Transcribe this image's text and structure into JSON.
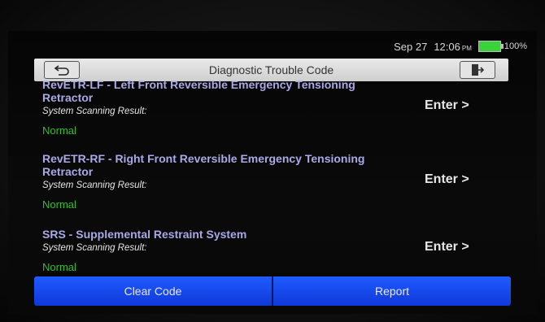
{
  "status_bar": {
    "date": "Sep 27",
    "time": "12:06",
    "ampm": "PM",
    "battery": "100%",
    "battery_color": "#3bd13b"
  },
  "header": {
    "title": "Diagnostic Trouble Code",
    "back_icon": "back-arrow-icon",
    "exit_icon": "exit-icon"
  },
  "systems": [
    {
      "title_line1": "RevETR-LF - Left Front Reversible Emergency Tensioning",
      "title_line2": "Retractor",
      "scan_label": "System Scanning Result:",
      "status": "Normal",
      "action": "Enter >"
    },
    {
      "title_line1": "RevETR-RF - Right Front Reversible Emergency Tensioning",
      "title_line2": "Retractor",
      "scan_label": "System Scanning Result:",
      "status": "Normal",
      "action": "Enter >"
    },
    {
      "title_line1": "SRS - Supplemental Restraint System",
      "title_line2": "",
      "scan_label": "System Scanning Result:",
      "status": "Normal",
      "action": "Enter >"
    }
  ],
  "footer": {
    "clear_label": "Clear Code",
    "report_label": "Report",
    "button_color": "#1e5cff"
  }
}
